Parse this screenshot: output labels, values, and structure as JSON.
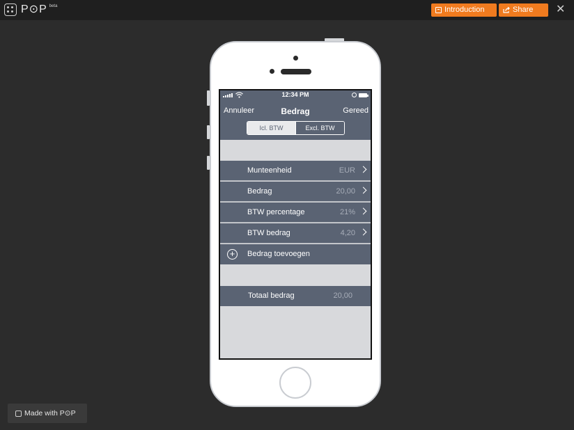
{
  "app": {
    "logo_text": "P⊙P",
    "beta": "beta",
    "made_with": "Made with P⊙P"
  },
  "toolbar": {
    "introduction_label": "Introduction",
    "share_label": "Share",
    "close_label": "✕"
  },
  "status": {
    "time": "12:34 PM"
  },
  "nav": {
    "left": "Annuleer",
    "title": "Bedrag",
    "right": "Gereed"
  },
  "segment": {
    "options": [
      "Icl. BTW",
      "Excl. BTW"
    ],
    "selected": "Icl. BTW"
  },
  "rows": [
    {
      "label": "Munteenheid",
      "value": "EUR"
    },
    {
      "label": "Bedrag",
      "value": "20,00"
    },
    {
      "label": "BTW percentage",
      "value": "21%"
    },
    {
      "label": "BTW bedrag",
      "value": "4,20"
    }
  ],
  "add_row": {
    "icon": "plus-circle-icon",
    "label": "Bedrag toevoegen"
  },
  "total": {
    "label": "Totaal bedrag",
    "value": "20,00"
  },
  "colors": {
    "accent": "#f07b1f",
    "navbar": "#5a6373",
    "screen_bg": "#d8d9dc",
    "page_bg": "#2c2c2c"
  }
}
